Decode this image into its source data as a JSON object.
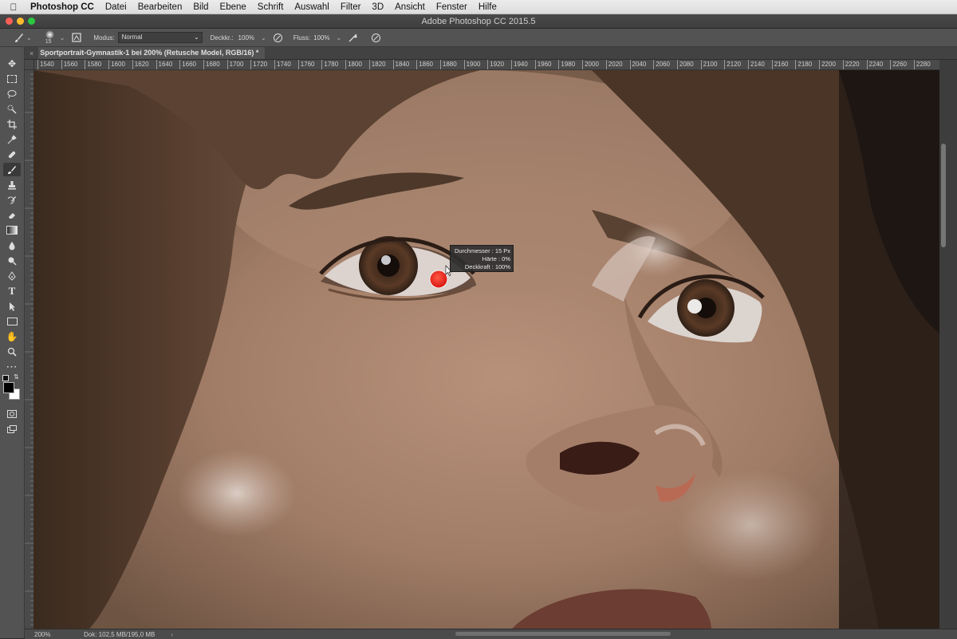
{
  "menubar": {
    "items": [
      "Photoshop CC",
      "Datei",
      "Bearbeiten",
      "Bild",
      "Ebene",
      "Schrift",
      "Auswahl",
      "Filter",
      "3D",
      "Ansicht",
      "Fenster",
      "Hilfe"
    ]
  },
  "window": {
    "title": "Adobe Photoshop CC 2015.5"
  },
  "options": {
    "brush_size": "15",
    "mode_label": "Modus:",
    "mode_value": "Normal",
    "opacity_label": "Deckkr.:",
    "opacity_value": "100%",
    "flow_label": "Fluss:",
    "flow_value": "100%"
  },
  "document": {
    "tab_title": "Sportportrait-Gymnastik-1 bei 200% (Retusche Model, RGB/16) *",
    "close_glyph": "×"
  },
  "ruler": {
    "h_ticks": [
      "1540",
      "1560",
      "1580",
      "1600",
      "1620",
      "1640",
      "1660",
      "1680",
      "1700",
      "1720",
      "1740",
      "1760",
      "1780",
      "1800",
      "1820",
      "1840",
      "1860",
      "1880",
      "1900",
      "1920",
      "1940",
      "1960",
      "1980",
      "2000",
      "2020",
      "2040",
      "2060",
      "2080",
      "2100",
      "2120",
      "2140",
      "2160",
      "2180",
      "2200",
      "2220",
      "2240",
      "2260",
      "2280"
    ]
  },
  "brush_tooltip": {
    "line1": "Durchmesser : 15 Px",
    "line2": "Härte :    0%",
    "line3": "Deckkraft : 100%"
  },
  "status": {
    "zoom": "200%",
    "doc_info": "Dok: 102,5 MB/195,0 MB",
    "arrow": "›"
  },
  "colors": {
    "brush_preview": "#e0201c",
    "panel": "#535353",
    "canvas_bg": "#7b5e48"
  }
}
